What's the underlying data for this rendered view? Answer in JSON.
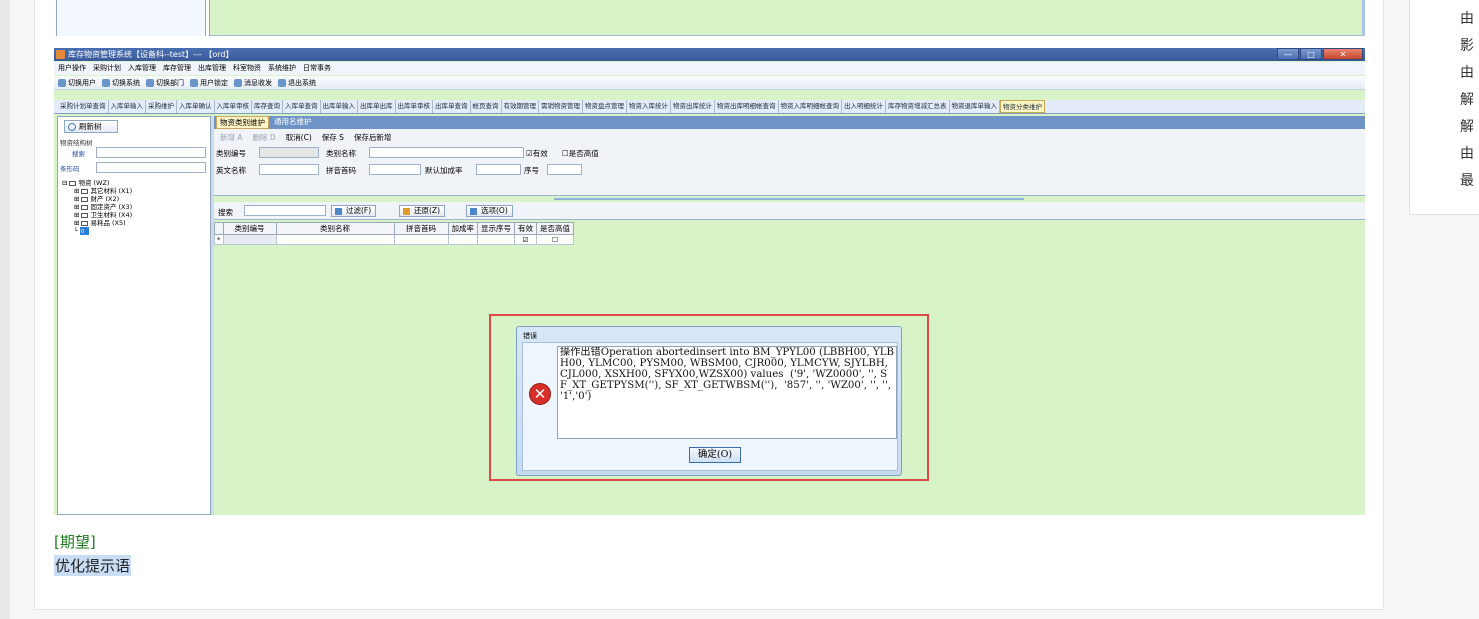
{
  "right_panel": {
    "lines": [
      "由",
      "影",
      "由",
      "解",
      "解",
      "由",
      "最"
    ]
  },
  "app": {
    "window_title": "库存物资管理系统【设备科--test】--- 【ord】",
    "window_buttons": {
      "minimize": "—",
      "maximize": "□",
      "close": "✕"
    },
    "menu": [
      "用户操作",
      "采购计划",
      "入库管理",
      "库存管理",
      "出库管理",
      "科室物资",
      "系统维护",
      "日常事务"
    ],
    "toolbar": [
      "切换用户",
      "切换系统",
      "切换部门",
      "用户锁定",
      "消息收发",
      "退出系统"
    ],
    "tabs": [
      "采购计划单查询",
      "入库单输入",
      "采购维护",
      "入库单确认",
      "入库单审核",
      "库存查询",
      "入库单查询",
      "出库单输入",
      "出库单出库",
      "出库单审核",
      "出库单查询",
      "帐页查询",
      "有效期管理",
      "需销物资管理",
      "物资盘点管理",
      "物资入库统计",
      "物资出库统计",
      "物资出库明细帐查询",
      "物资入库明细帐查询",
      "出入明细统计",
      "库存物资增减汇总表",
      "物资退库单输入",
      "物资分类维护"
    ],
    "active_tab_index": 22,
    "left": {
      "refresh_label": "刷新树",
      "tree_title": "物资结构树",
      "search_label": "搜索",
      "barcode_label": "条形码",
      "tree": {
        "root": "物资 (WZ)",
        "children": [
          "其它材料 (X1)",
          "财产 (X2)",
          "固定资产 (X3)",
          "卫生材料 (X4)",
          "易耗品 (X5)"
        ],
        "leaf": "0"
      }
    },
    "right": {
      "tabs": [
        "物资类别维护",
        "通用名维护"
      ],
      "form_toolbar": {
        "add": "新增 A",
        "delete": "删除 D",
        "cancel": "取消(C)",
        "save": "保存 S",
        "save_new": "保存后新增"
      },
      "fields": {
        "code_label": "类别编号",
        "name_label": "类别名称",
        "valid_label": "☑有效",
        "high_value_label": "☐是否高值",
        "en_name_label": "英文名称",
        "pinyin_label": "拼音首码",
        "markup_label": "默认加成率",
        "seq_label": "序号"
      },
      "search_label": "搜索",
      "filter_btn": "过滤(F)",
      "restore_btn": "还原(Z)",
      "options_btn": "选项(O)",
      "grid": {
        "columns": [
          "类别编号",
          "类别名称",
          "拼音首码",
          "加成率",
          "显示序号",
          "有效",
          "是否高值"
        ],
        "row_marker": "*",
        "row_valid": "☑",
        "row_high": "☐"
      }
    },
    "dialog": {
      "title": "错误",
      "icon": "error-icon",
      "message": "操作出错Operation abortedinsert into BM_YPYL00 (LBBH00, YLBH00, YLMC00, PYSM00, WBSM00, CJR000, YLMCYW, SJYLBH, CJL000, XSXH00, SFYX00,WZSX00) values  ('9', 'WZ0000', '', SF_XT_GETPYSM(''), SF_XT_GETWBSM(''),  '857', '', 'WZ00', '', '', '1','0')",
      "ok_label": "确定(O)"
    }
  },
  "expectation_label": "[期望]",
  "expectation_text": "优化提示语"
}
